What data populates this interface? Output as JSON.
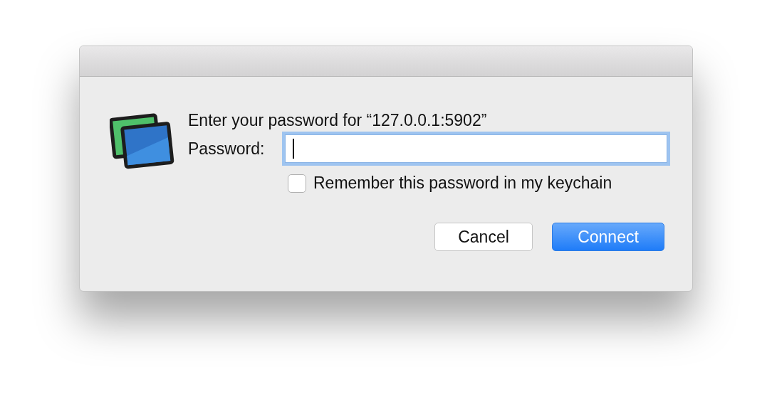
{
  "dialog": {
    "message": "Enter your password for “127.0.0.1:5902”",
    "password": {
      "label": "Password:",
      "focused": true
    },
    "remember": {
      "label": "Remember this password in my keychain",
      "checked": false
    },
    "buttons": [
      {
        "label": "Cancel",
        "default": false
      },
      {
        "label": "Connect",
        "default": true
      }
    ]
  }
}
